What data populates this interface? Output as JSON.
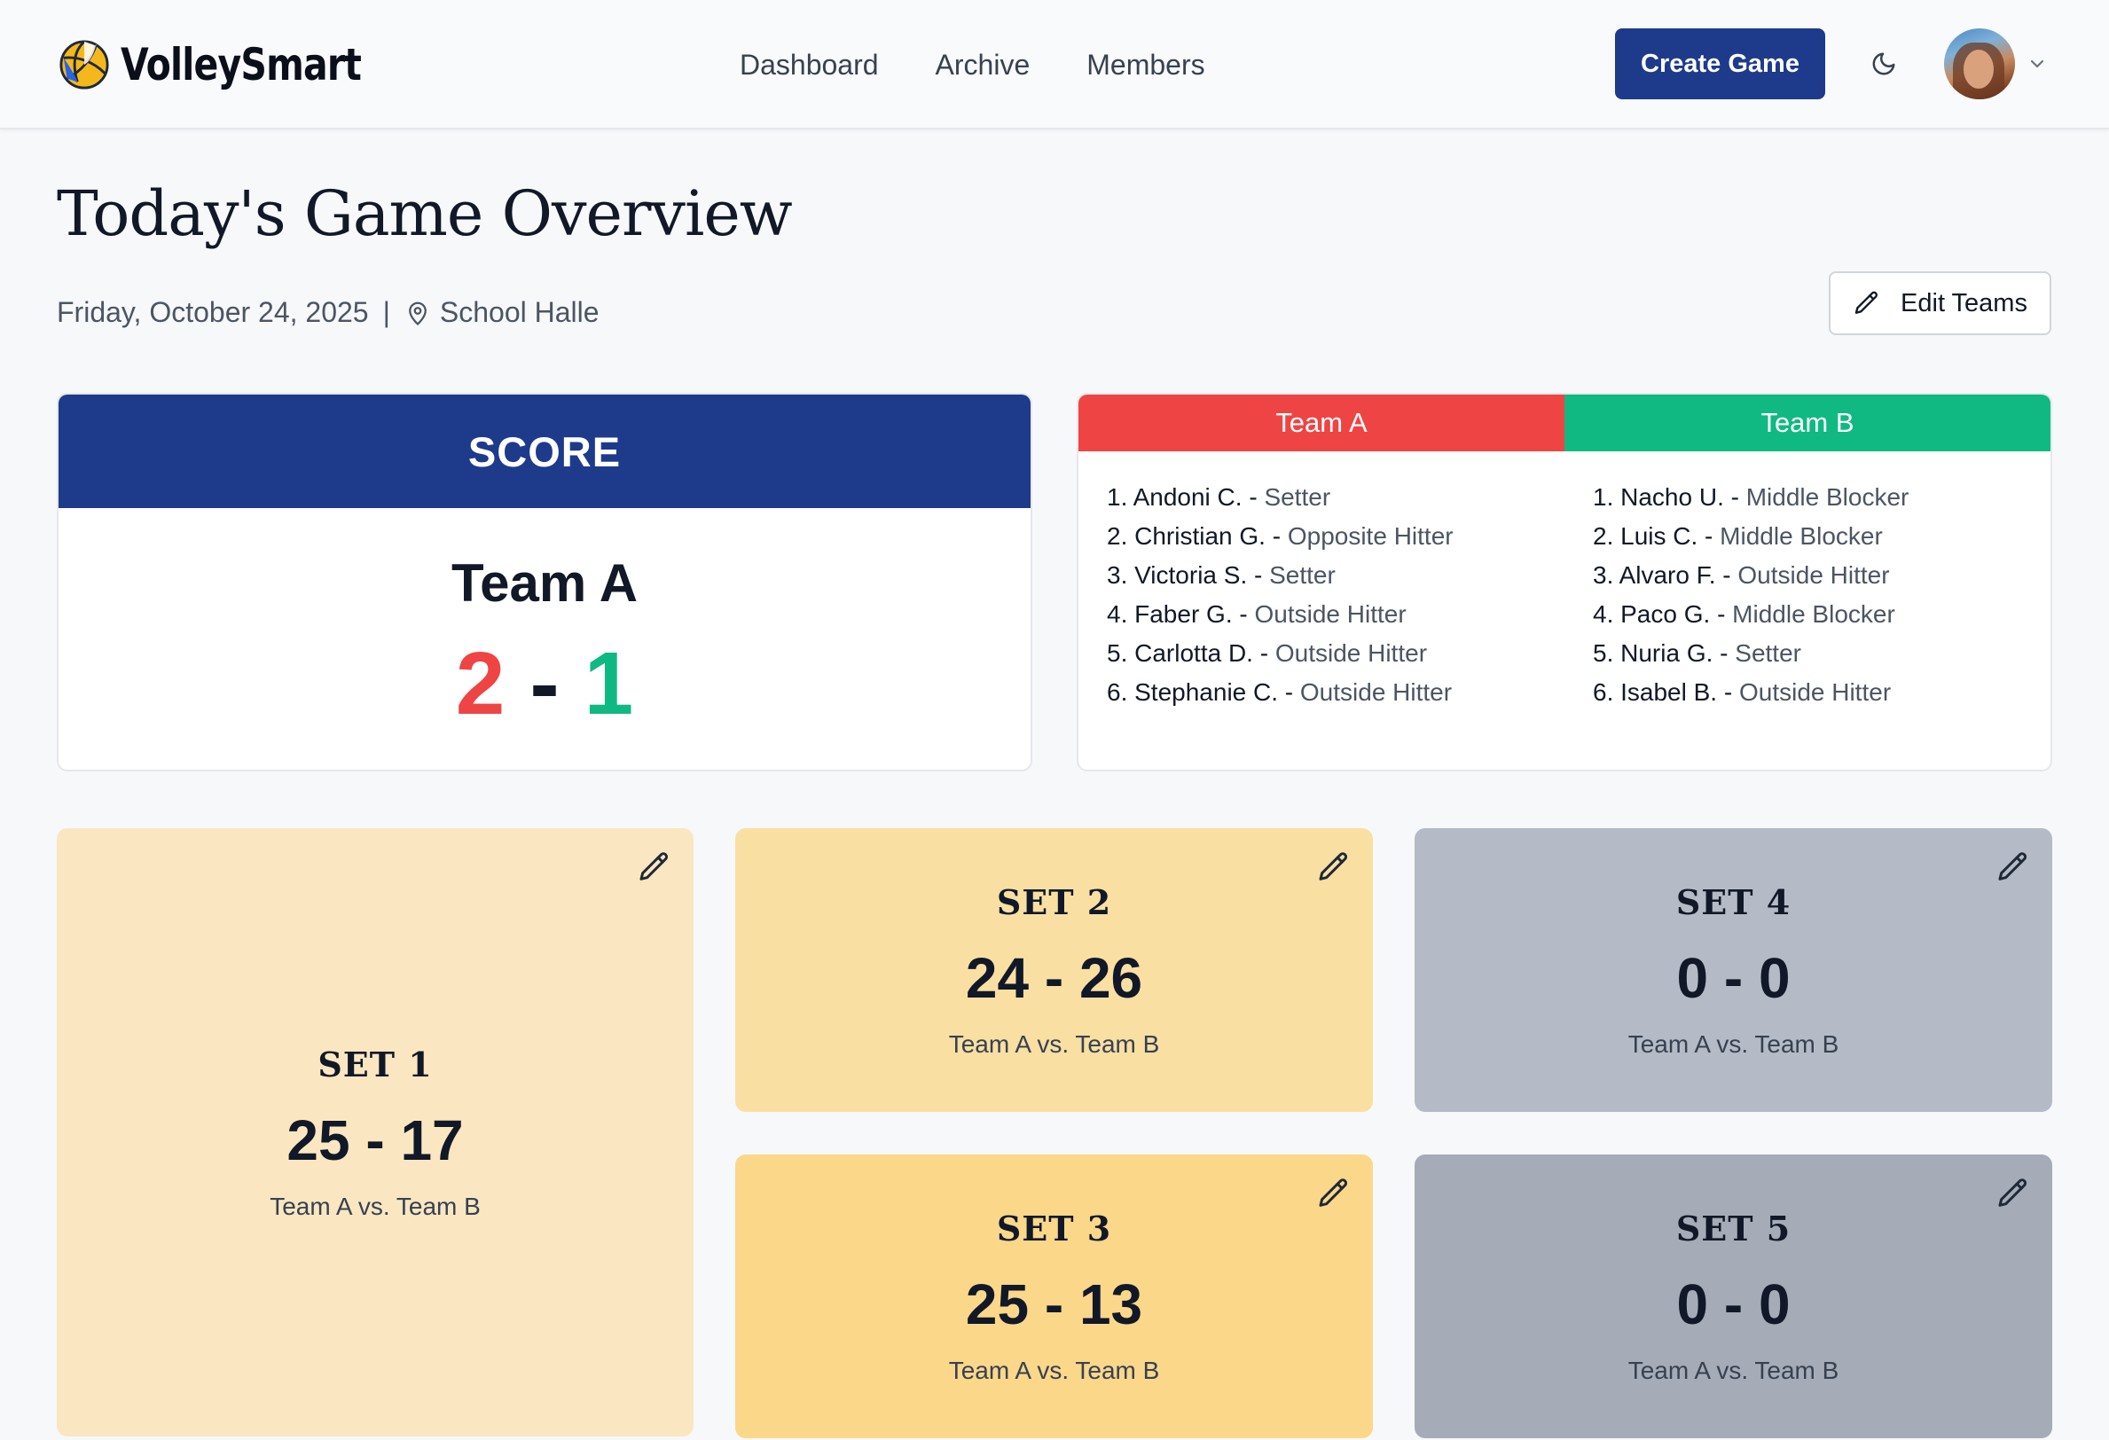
{
  "header": {
    "brand": "VolleySmart",
    "nav": [
      "Dashboard",
      "Archive",
      "Members"
    ],
    "create_button": "Create Game",
    "theme_icon": "moon-icon",
    "avatar_icon": "user-avatar",
    "menu_icon": "chevron-down-icon"
  },
  "page": {
    "title": "Today's Game Overview",
    "date": "Friday, October 24, 2025",
    "separator": "|",
    "location": "School Halle",
    "edit_teams_label": "Edit Teams"
  },
  "score": {
    "header": "SCORE",
    "leader": "Team A",
    "team_a_sets": "2",
    "dash": "-",
    "team_b_sets": "1"
  },
  "roster": {
    "team_a": {
      "name": "Team A",
      "players": [
        {
          "name": "1. Andoni C. - ",
          "role": "Setter"
        },
        {
          "name": "2. Christian G. - ",
          "role": "Opposite Hitter"
        },
        {
          "name": "3. Victoria S. - ",
          "role": "Setter"
        },
        {
          "name": "4. Faber G. - ",
          "role": "Outside Hitter"
        },
        {
          "name": "5. Carlotta D. - ",
          "role": "Outside Hitter"
        },
        {
          "name": "6. Stephanie C. - ",
          "role": "Outside Hitter"
        }
      ]
    },
    "team_b": {
      "name": "Team B",
      "players": [
        {
          "name": "1. Nacho U. - ",
          "role": "Middle Blocker"
        },
        {
          "name": "2. Luis C. - ",
          "role": "Middle Blocker"
        },
        {
          "name": "3. Alvaro F. - ",
          "role": "Outside Hitter"
        },
        {
          "name": "4. Paco G. - ",
          "role": "Middle Blocker"
        },
        {
          "name": "5. Nuria G. - ",
          "role": "Setter"
        },
        {
          "name": "6. Isabel B. - ",
          "role": "Outside Hitter"
        }
      ]
    }
  },
  "sets": [
    {
      "title": "SET 1",
      "score": "25 - 17",
      "matchup": "Team A vs. Team B"
    },
    {
      "title": "SET 2",
      "score": "24 - 26",
      "matchup": "Team A vs. Team B"
    },
    {
      "title": "SET 3",
      "score": "25 - 13",
      "matchup": "Team A vs. Team B"
    },
    {
      "title": "SET 4",
      "score": "0 - 0",
      "matchup": "Team A vs. Team B"
    },
    {
      "title": "SET 5",
      "score": "0 - 0",
      "matchup": "Team A vs. Team B"
    }
  ],
  "colors": {
    "primary": "#1e3a8a",
    "team_a": "#ef4444",
    "team_b": "#10b981"
  }
}
